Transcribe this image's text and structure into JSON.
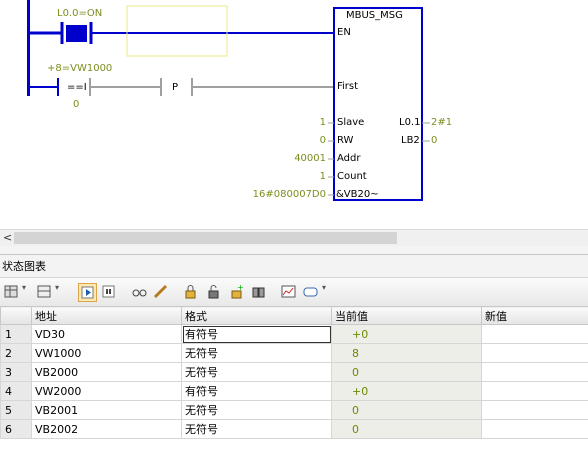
{
  "ladder": {
    "contact1_label": "L0.0=ON",
    "compare_label": "+8=VW1000",
    "compare_op": "==I",
    "compare_value": "0",
    "pulse_label": "P",
    "block": {
      "title": "MBUS_MSG",
      "en": "EN",
      "first": "First",
      "slave_in": "1",
      "slave": "Slave",
      "rw_in": "0",
      "rw": "RW",
      "addr_in": "40001",
      "addr": "Addr",
      "count_in": "1",
      "count": "Count",
      "ptr_in": "16#080007D0",
      "ptr": "&VB20~",
      "done_out": "L0.1",
      "done_val": "2#1",
      "error_out": "LB2",
      "error_val": "0"
    }
  },
  "panel": {
    "title": "状态图表"
  },
  "toolbar": {
    "icons": [
      "table-icon",
      "dropdown-icon",
      "insert-row-icon",
      "dropdown-icon",
      "run-icon",
      "stop-icon",
      "glasses-icon",
      "pencil-icon",
      "lock-icon",
      "unlock-icon",
      "force-icon",
      "unforce-icon",
      "read-icon",
      "trend-icon",
      "label-icon"
    ]
  },
  "table": {
    "headers": [
      "地址",
      "格式",
      "当前值",
      "新值"
    ],
    "rows": [
      {
        "n": "1",
        "addr": "VD30",
        "fmt": "有符号",
        "cur": "+0",
        "new": ""
      },
      {
        "n": "2",
        "addr": "VW1000",
        "fmt": "无符号",
        "cur": "8",
        "new": ""
      },
      {
        "n": "3",
        "addr": "VB2000",
        "fmt": "无符号",
        "cur": "0",
        "new": ""
      },
      {
        "n": "4",
        "addr": "VW2000",
        "fmt": "有符号",
        "cur": "+0",
        "new": ""
      },
      {
        "n": "5",
        "addr": "VB2001",
        "fmt": "无符号",
        "cur": "0",
        "new": ""
      },
      {
        "n": "6",
        "addr": "VB2002",
        "fmt": "无符号",
        "cur": "0",
        "new": ""
      }
    ]
  },
  "colors": {
    "energized": "#0000cc",
    "value": "#7a8f1e",
    "wire_gray": "#a0a0a0"
  }
}
